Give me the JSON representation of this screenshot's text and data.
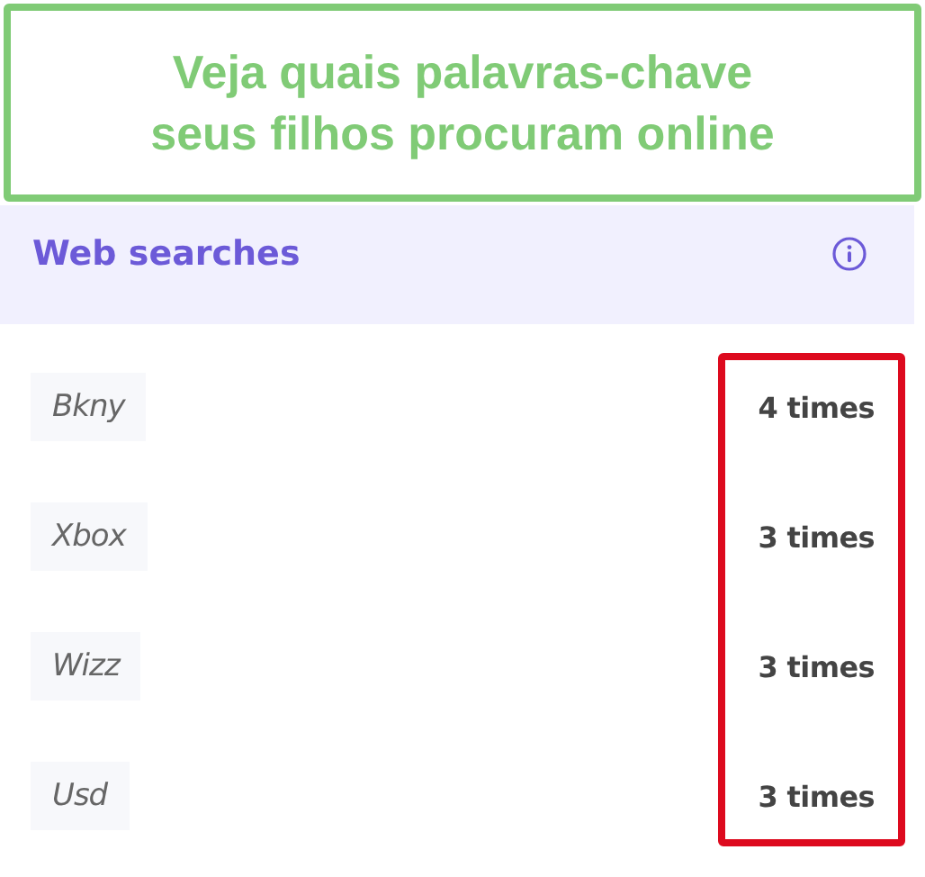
{
  "callout": {
    "lines": [
      "Veja quais palavras-chave",
      "seus filhos procuram online"
    ]
  },
  "panel": {
    "title": "Web searches",
    "searches": [
      {
        "term": "Bkny",
        "count": "4 times"
      },
      {
        "term": "Xbox",
        "count": "3 times"
      },
      {
        "term": "Wizz",
        "count": "3 times"
      },
      {
        "term": "Usd",
        "count": "3 times"
      }
    ],
    "counts_highlighted": true
  }
}
